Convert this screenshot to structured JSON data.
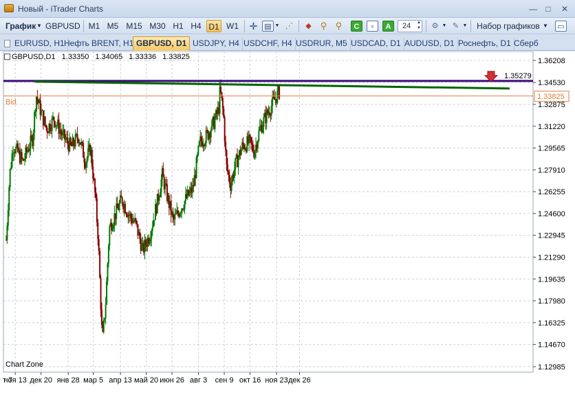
{
  "window": {
    "title": "Новый - iTrader Charts",
    "minimize": "—",
    "maximize": "□",
    "close": "✕"
  },
  "toolbar": {
    "chart_menu": "График",
    "symbol": "GBPUSD",
    "timeframes": [
      "M1",
      "M5",
      "M15",
      "M30",
      "H1",
      "H4",
      "D1",
      "W1"
    ],
    "active_timeframe": "D1",
    "bars_count": "24",
    "chart_sets": "Набор графиков"
  },
  "tabs": [
    {
      "label": "EURUSD, H1",
      "active": false
    },
    {
      "label": "Нефть BRENT, H1",
      "active": false
    },
    {
      "label": "GBPUSD, D1",
      "active": true
    },
    {
      "label": "USDJPY, H4",
      "active": false
    },
    {
      "label": "USDCHF, H4",
      "active": false
    },
    {
      "label": "USDRUR, M5",
      "active": false
    },
    {
      "label": "USDCAD, D1",
      "active": false
    },
    {
      "label": "AUDUSD, D1",
      "active": false
    },
    {
      "label": "Роснефть, D1",
      "active": false
    },
    {
      "label": "Сберб",
      "active": false
    }
  ],
  "chart": {
    "symbol_line": "GBPUSD,D1",
    "open": "1.33350",
    "high": "1.34065",
    "low": "1.33336",
    "close": "1.33825",
    "bid_label": "Bid",
    "bid_value": "1.33825",
    "alert_value": "1.35279",
    "zone_label": "Chart Zone",
    "colors": {
      "bid_line": "#e07b3c",
      "resistance": "#3a0c7a",
      "trendline": "#006400",
      "bull": "#007a00",
      "bear": "#8b0000",
      "alert": "#d32f2f"
    }
  },
  "chart_data": {
    "type": "candlestick",
    "y_ticks": [
      "1.36208",
      "1.34530",
      "1.32875",
      "1.31220",
      "1.29565",
      "1.27910",
      "1.26255",
      "1.24600",
      "1.22945",
      "1.21290",
      "1.19635",
      "1.17980",
      "1.16325",
      "1.14670",
      "1.12985"
    ],
    "x_ticks": [
      "т 7",
      "ноя 13",
      "дек 20",
      "янв 28",
      "мар 5",
      "апр 13",
      "май 20",
      "июн 26",
      "авг 3",
      "сен 9",
      "окт 16",
      "ноя 23",
      "дек 26"
    ],
    "ylim": [
      1.12985,
      1.36208
    ],
    "horizontal_lines": [
      {
        "name": "Bid",
        "value": 1.33825
      },
      {
        "name": "alert",
        "value": 1.35279
      }
    ],
    "trendline": {
      "from": {
        "date": "дек 11",
        "value": 1.3528
      },
      "to": {
        "date": "дек 5",
        "value": 1.3468
      }
    },
    "path": [
      {
        "date": "окт 31",
        "value": 1.226
      },
      {
        "date": "ноя 5",
        "value": 1.275
      },
      {
        "date": "ноя 10",
        "value": 1.298
      },
      {
        "date": "ноя 17",
        "value": 1.292
      },
      {
        "date": "ноя 24",
        "value": 1.285
      },
      {
        "date": "дек 1",
        "value": 1.295
      },
      {
        "date": "дек 8",
        "value": 1.303
      },
      {
        "date": "дек 13",
        "value": 1.336
      },
      {
        "date": "дек 20",
        "value": 1.323
      },
      {
        "date": "дек 28",
        "value": 1.31
      },
      {
        "date": "янв 8",
        "value": 1.318
      },
      {
        "date": "янв 20",
        "value": 1.305
      },
      {
        "date": "фев 1",
        "value": 1.296
      },
      {
        "date": "фев 12",
        "value": 1.305
      },
      {
        "date": "фев 22",
        "value": 1.285
      },
      {
        "date": "мар 1",
        "value": 1.296
      },
      {
        "date": "мар 8",
        "value": 1.258
      },
      {
        "date": "мар 12",
        "value": 1.228
      },
      {
        "date": "мар 18",
        "value": 1.148
      },
      {
        "date": "мар 23",
        "value": 1.18
      },
      {
        "date": "мар 28",
        "value": 1.235
      },
      {
        "date": "апр 6",
        "value": 1.246
      },
      {
        "date": "апр 15",
        "value": 1.257
      },
      {
        "date": "апр 25",
        "value": 1.245
      },
      {
        "date": "май 5",
        "value": 1.238
      },
      {
        "date": "май 15",
        "value": 1.218
      },
      {
        "date": "май 25",
        "value": 1.23
      },
      {
        "date": "июн 5",
        "value": 1.255
      },
      {
        "date": "июн 12",
        "value": 1.275
      },
      {
        "date": "июн 20",
        "value": 1.257
      },
      {
        "date": "июн 28",
        "value": 1.24
      },
      {
        "date": "июл 6",
        "value": 1.248
      },
      {
        "date": "июл 16",
        "value": 1.257
      },
      {
        "date": "июл 26",
        "value": 1.265
      },
      {
        "date": "авг 5",
        "value": 1.3
      },
      {
        "date": "авг 15",
        "value": 1.305
      },
      {
        "date": "авг 25",
        "value": 1.315
      },
      {
        "date": "сен 1",
        "value": 1.325
      },
      {
        "date": "сен 3",
        "value": 1.34
      },
      {
        "date": "сен 8",
        "value": 1.32
      },
      {
        "date": "сен 12",
        "value": 1.282
      },
      {
        "date": "сен 18",
        "value": 1.268
      },
      {
        "date": "сен 25",
        "value": 1.283
      },
      {
        "date": "окт 5",
        "value": 1.297
      },
      {
        "date": "окт 15",
        "value": 1.3
      },
      {
        "date": "окт 22",
        "value": 1.293
      },
      {
        "date": "окт 30",
        "value": 1.31
      },
      {
        "date": "ноя 8",
        "value": 1.32
      },
      {
        "date": "ноя 16",
        "value": 1.328
      },
      {
        "date": "ноя 23",
        "value": 1.335
      },
      {
        "date": "ноя 27",
        "value": 1.338
      }
    ]
  }
}
